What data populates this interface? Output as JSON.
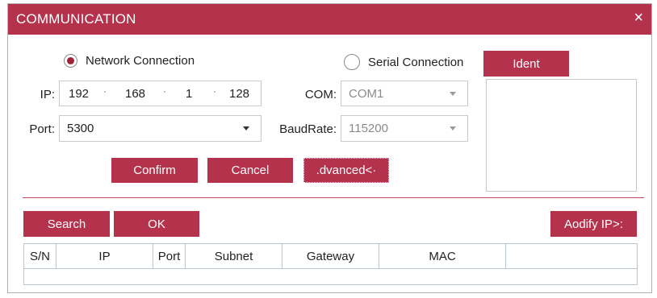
{
  "dialog": {
    "title": "COMMUNICATION",
    "close_glyph": "×"
  },
  "connection": {
    "network_label": "Network Connection",
    "network_selected": true,
    "serial_label": "Serial Connection",
    "serial_selected": false
  },
  "network": {
    "ip_label": "IP:",
    "ip": [
      "192",
      "168",
      "1",
      "128"
    ],
    "ip_separator": "·",
    "port_label": "Port:",
    "port_value": "5300"
  },
  "serial": {
    "com_label": "COM:",
    "com_value": "COM1",
    "baud_label": "BaudRate:",
    "baud_value": "115200"
  },
  "buttons": {
    "ident": "Ident",
    "confirm": "Confirm",
    "cancel": "Cancel",
    "advanced": ".dvanced<·",
    "search": "Search",
    "ok": "OK",
    "modify_ip": "Aodify IP>:"
  },
  "table": {
    "columns": [
      "S/N",
      "IP",
      "Port",
      "Subnet",
      "Gateway",
      "MAC",
      ""
    ],
    "rows": []
  },
  "colors": {
    "accent": "#b5324c",
    "radio_dot": "#a02238"
  }
}
